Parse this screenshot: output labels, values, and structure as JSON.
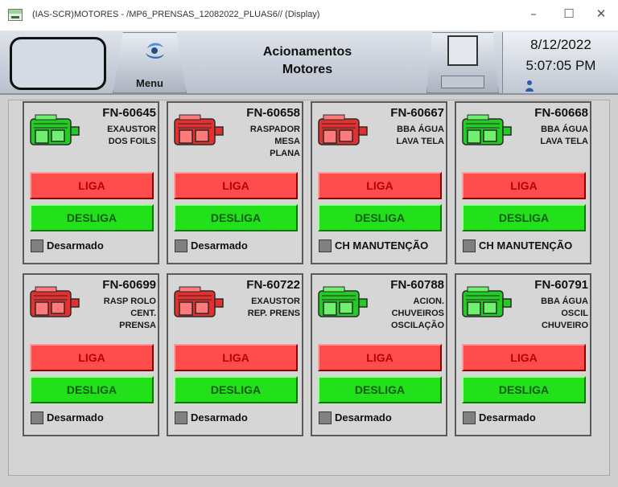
{
  "window": {
    "title": "(IAS-SCR)MOTORES - /MP6_PRENSAS_12082022_PLUAS6// (Display)",
    "min_glyph": "–",
    "max_glyph": "☐",
    "close_glyph": "✕"
  },
  "header": {
    "menu_label": "Menu",
    "title_line1": "Acionamentos",
    "title_line2": "Motores",
    "date": "8/12/2022",
    "time": "5:07:05 PM"
  },
  "colors": {
    "running": "#22cc22",
    "stopped": "#e63030",
    "liga": "#ff4d4d",
    "desliga": "#22e01a"
  },
  "motors": [
    {
      "tag": "FN-60645",
      "desc": [
        "EXAUSTOR",
        "DOS FOILS"
      ],
      "state": "running",
      "liga": "LIGA",
      "desliga": "DESLIGA",
      "status": "Desarmado"
    },
    {
      "tag": "FN-60658",
      "desc": [
        "RASPADOR",
        "MESA",
        "PLANA"
      ],
      "state": "stopped",
      "liga": "LIGA",
      "desliga": "DESLIGA",
      "status": "Desarmado"
    },
    {
      "tag": "FN-60667",
      "desc": [
        "BBA ÁGUA",
        "LAVA TELA"
      ],
      "state": "stopped",
      "liga": "LIGA",
      "desliga": "DESLIGA",
      "status": "CH MANUTENÇÃO"
    },
    {
      "tag": "FN-60668",
      "desc": [
        "BBA ÁGUA",
        "LAVA TELA"
      ],
      "state": "running",
      "liga": "LIGA",
      "desliga": "DESLIGA",
      "status": "CH MANUTENÇÃO"
    },
    {
      "tag": "FN-60699",
      "desc": [
        "RASP ROLO",
        "CENT.",
        "PRENSA"
      ],
      "state": "stopped",
      "liga": "LIGA",
      "desliga": "DESLIGA",
      "status": "Desarmado"
    },
    {
      "tag": "FN-60722",
      "desc": [
        "EXAUSTOR",
        "REP. PRENS"
      ],
      "state": "stopped",
      "liga": "LIGA",
      "desliga": "DESLIGA",
      "status": "Desarmado"
    },
    {
      "tag": "FN-60788",
      "desc": [
        "ACION.",
        "CHUVEIROS",
        "OSCILAÇÃO"
      ],
      "state": "running",
      "liga": "LIGA",
      "desliga": "DESLIGA",
      "status": "Desarmado"
    },
    {
      "tag": "FN-60791",
      "desc": [
        "BBA ÁGUA",
        "OSCIL",
        "CHUVEIRO"
      ],
      "state": "running",
      "liga": "LIGA",
      "desliga": "DESLIGA",
      "status": "Desarmado"
    }
  ]
}
